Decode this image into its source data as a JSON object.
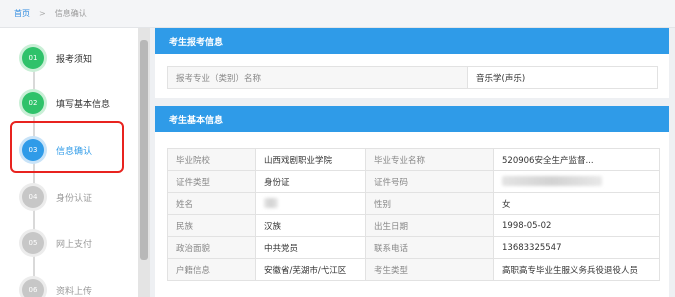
{
  "breadcrumb": {
    "home": "首页",
    "separator": ">",
    "current": "信息确认"
  },
  "steps": [
    {
      "num": "01",
      "label": "报考须知",
      "state": "done"
    },
    {
      "num": "02",
      "label": "填写基本信息",
      "state": "done"
    },
    {
      "num": "03",
      "label": "信息确认",
      "state": "active"
    },
    {
      "num": "04",
      "label": "身份认证",
      "state": "pending"
    },
    {
      "num": "05",
      "label": "网上支付",
      "state": "pending"
    },
    {
      "num": "06",
      "label": "资料上传",
      "state": "pending"
    }
  ],
  "panel_apply": {
    "title": "考生报考信息",
    "field_label": "报考专业（类别）名称",
    "field_value": "音乐学(声乐)"
  },
  "panel_basic": {
    "title": "考生基本信息",
    "rows": [
      {
        "k1": "毕业院校",
        "v1": "山西戏剧职业学院",
        "k2": "毕业专业名称",
        "v2": "520906安全生产监督..."
      },
      {
        "k1": "证件类型",
        "v1": "身份证",
        "k2": "证件号码",
        "v2": ""
      },
      {
        "k1": "姓名",
        "v1": "",
        "k2": "性别",
        "v2": "女"
      },
      {
        "k1": "民族",
        "v1": "汉族",
        "k2": "出生日期",
        "v2": "1998-05-02"
      },
      {
        "k1": "政治面貌",
        "v1": "中共党员",
        "k2": "联系电话",
        "v2": "13683325547"
      },
      {
        "k1": "户籍信息",
        "v1": "安徽省/芜湖市/弋江区",
        "k2": "考生类型",
        "v2": "高职高专毕业生服义务兵役退役人员"
      }
    ]
  },
  "colors": {
    "accent": "#2f9be8",
    "done": "#2fc26a",
    "highlight": "#e8231f"
  }
}
